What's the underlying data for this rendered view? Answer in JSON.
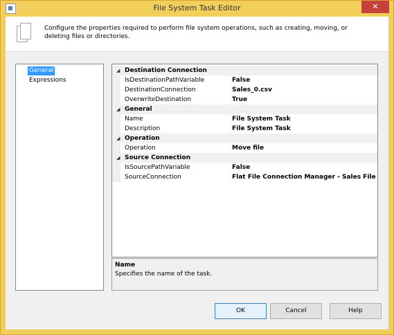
{
  "window": {
    "title": "File System Task Editor",
    "close_glyph": "✕"
  },
  "header": {
    "description": "Configure the properties required to perform file system operations, such as creating, moving, or deleting files or directories."
  },
  "nav": {
    "items": [
      {
        "label": "General"
      },
      {
        "label": "Expressions"
      }
    ]
  },
  "grid": {
    "rows": [
      {
        "label": "Destination Connection"
      },
      {
        "name": "IsDestinationPathVariable",
        "value": "False"
      },
      {
        "name": "DestinationConnection",
        "value": "Sales_0.csv"
      },
      {
        "name": "OverwriteDestination",
        "value": "True"
      },
      {
        "label": "General"
      },
      {
        "name": "Name",
        "value": "File System Task"
      },
      {
        "name": "Description",
        "value": "File System Task"
      },
      {
        "label": "Operation"
      },
      {
        "name": "Operation",
        "value": "Move file"
      },
      {
        "label": "Source Connection"
      },
      {
        "name": "IsSourcePathVariable",
        "value": "False"
      },
      {
        "name": "SourceConnection",
        "value": "Flat File Connection Manager - Sales File"
      }
    ]
  },
  "description_box": {
    "title": "Name",
    "text": "Specifies the name of the task."
  },
  "buttons": {
    "ok": "OK",
    "cancel": "Cancel",
    "help": "Help"
  },
  "icons": {
    "app": "window-icon",
    "header": "documents-icon",
    "collapse": "collapse-arrow-icon"
  }
}
